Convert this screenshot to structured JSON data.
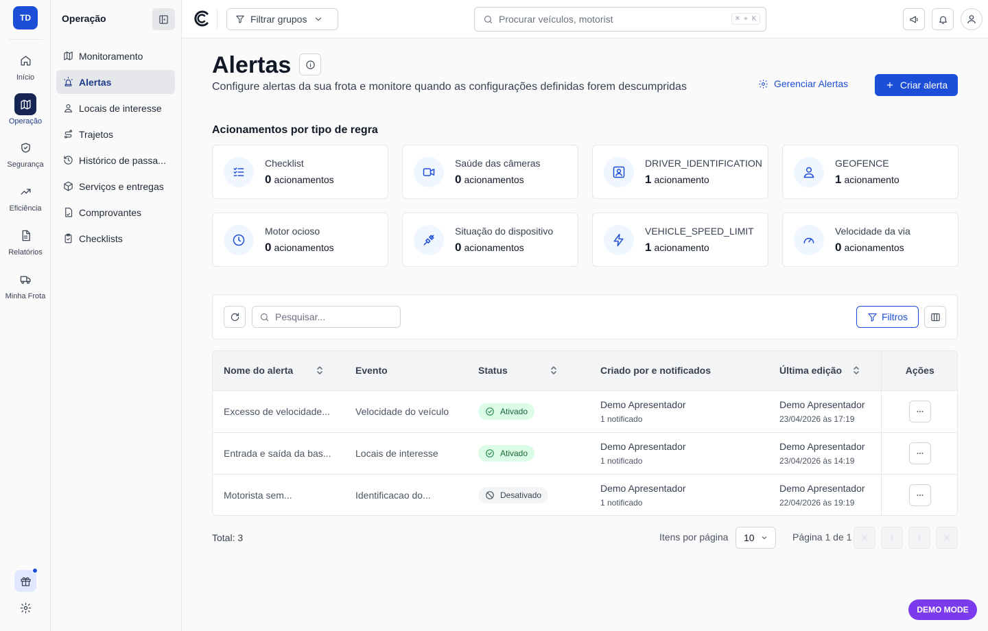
{
  "rail": {
    "avatar": "TD",
    "items": [
      {
        "label": "Início",
        "icon": "home-icon"
      },
      {
        "label": "Operação",
        "icon": "map-icon"
      },
      {
        "label": "Segurança",
        "icon": "shield-check-icon"
      },
      {
        "label": "Eficiência",
        "icon": "trending-up-icon"
      },
      {
        "label": "Relatórios",
        "icon": "document-icon"
      },
      {
        "label": "Minha Frota",
        "icon": "truck-icon"
      }
    ],
    "active": "Operação"
  },
  "sidebar": {
    "title": "Operação",
    "items": [
      {
        "label": "Monitoramento",
        "icon": "map-icon"
      },
      {
        "label": "Alertas",
        "icon": "siren-icon"
      },
      {
        "label": "Locais de interesse",
        "icon": "map-pin-user-icon"
      },
      {
        "label": "Trajetos",
        "icon": "route-icon"
      },
      {
        "label": "Histórico de passa...",
        "icon": "history-icon"
      },
      {
        "label": "Serviços e entregas",
        "icon": "package-icon"
      },
      {
        "label": "Comprovantes",
        "icon": "receipt-icon"
      },
      {
        "label": "Checklists",
        "icon": "clipboard-check-icon"
      }
    ],
    "active": "Alertas"
  },
  "topbar": {
    "group_filter": "Filtrar grupos",
    "search_placeholder": "Procurar veículos, motorist",
    "shortcut": "⌘ + K"
  },
  "page": {
    "title": "Alertas",
    "subtitle": "Configure alertas da sua frota e monitore quando as configurações definidas forem descumpridas",
    "manage_label": "Gerenciar Alertas",
    "create_label": "Criar alerta",
    "section_title": "Acionamentos por tipo de regra"
  },
  "cards": [
    {
      "name": "Checklist",
      "count": "0",
      "unit": "acionamentos",
      "icon": "list-check-icon"
    },
    {
      "name": "Saúde das câmeras",
      "count": "0",
      "unit": "acionamentos",
      "icon": "video-icon"
    },
    {
      "name": "DRIVER_IDENTIFICATION",
      "count": "1",
      "unit": "acionamento",
      "icon": "user-square-icon"
    },
    {
      "name": "GEOFENCE",
      "count": "1",
      "unit": "acionamento",
      "icon": "map-pin-user-icon"
    },
    {
      "name": "Motor ocioso",
      "count": "0",
      "unit": "acionamentos",
      "icon": "clock-icon"
    },
    {
      "name": "Situação do dispositivo",
      "count": "0",
      "unit": "acionamentos",
      "icon": "plug-icon"
    },
    {
      "name": "VEHICLE_SPEED_LIMIT",
      "count": "1",
      "unit": "acionamento",
      "icon": "zap-icon"
    },
    {
      "name": "Velocidade da via",
      "count": "0",
      "unit": "acionamentos",
      "icon": "gauge-icon"
    }
  ],
  "table": {
    "search_placeholder": "Pesquisar...",
    "filters_label": "Filtros",
    "headers": {
      "name": "Nome do alerta",
      "event": "Evento",
      "status": "Status",
      "creator": "Criado por e notificados",
      "edited": "Última edição",
      "actions": "Ações"
    },
    "rows": [
      {
        "name": "Excesso de velocidade...",
        "event": "Velocidade do veículo",
        "status": "Ativado",
        "creator": "Demo Apresentador",
        "notified": "1 notificado",
        "editor": "Demo Apresentador",
        "edited_at": "23/04/2026 às 17:19"
      },
      {
        "name": "Entrada e saída da bas...",
        "event": "Locais de interesse",
        "status": "Ativado",
        "creator": "Demo Apresentador",
        "notified": "1 notificado",
        "editor": "Demo Apresentador",
        "edited_at": "23/04/2026 às 14:19"
      },
      {
        "name": "Motorista sem...",
        "event": "Identificacao do...",
        "status": "Desativado",
        "creator": "Demo Apresentador",
        "notified": "1 notificado",
        "editor": "Demo Apresentador",
        "edited_at": "22/04/2026 às 19:19"
      }
    ]
  },
  "footer": {
    "total": "Total: 3",
    "per_page_label": "Itens por página",
    "per_page_value": "10",
    "page_info": "Página 1 de 1"
  },
  "demo_badge": "DEMO MODE",
  "colors": {
    "accent": "#1d4ed8",
    "active_nav": "#172554",
    "status_on": "#dcfce7",
    "demo": "#7c3aed"
  }
}
